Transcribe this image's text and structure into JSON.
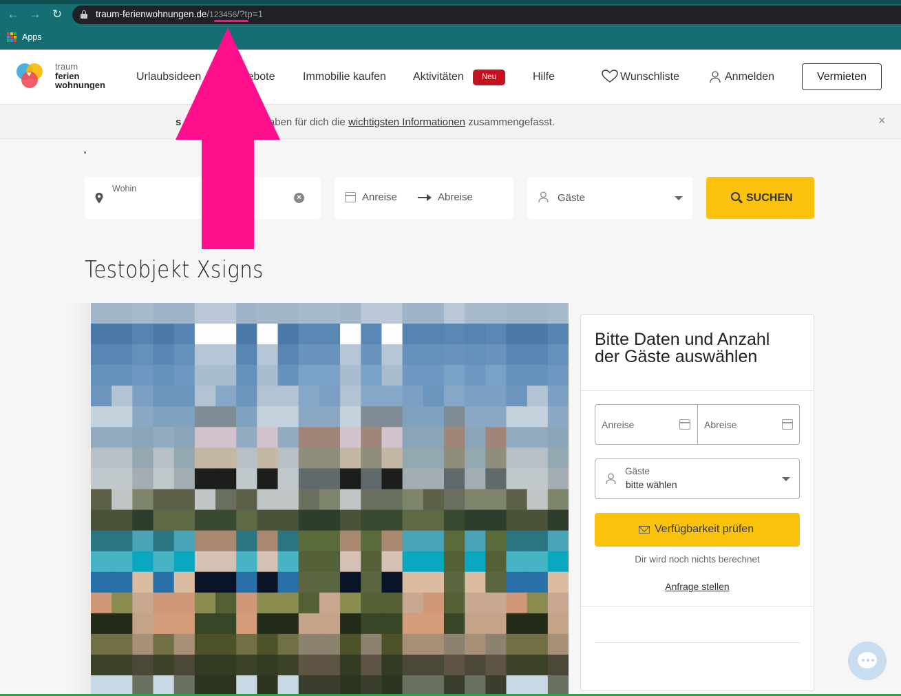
{
  "browser": {
    "url_host": "traum-ferienwohnungen.de",
    "url_sep": "/",
    "url_id": "123456",
    "url_rest": "/?tp=1",
    "bookmark_apps": "Apps"
  },
  "colors": {
    "accent_yellow": "#fbc20d",
    "badge_red": "#c4131f",
    "annotation_pink": "#ff0f8c",
    "chrome_teal": "#156e72"
  },
  "header": {
    "logo": [
      "traum",
      "ferien",
      "wohnungen"
    ],
    "nav": [
      "Urlaubsideen",
      "Angebote",
      "Immobilie kaufen",
      "Aktivitäten",
      "Hilfe"
    ],
    "badge_new": "Neu",
    "wishlist": "Wunschliste",
    "login": "Anmelden",
    "rent_button": "Vermieten"
  },
  "banner": {
    "prefix": "s (COVID-19):",
    "text1": " Wir haben für dich die ",
    "link": "wichtigsten Informationen",
    "text2": " zusammengefasst."
  },
  "search": {
    "where_label": "Wohin",
    "arrival": "Anreise",
    "departure": "Abreise",
    "guests": "Gäste",
    "search_button": "SUCHEN"
  },
  "page": {
    "title": "Testobjekt Xsigns"
  },
  "booking": {
    "title": "Bitte Daten und Anzahl der Gäste auswählen",
    "arrival": "Anreise",
    "departure": "Abreise",
    "guests_label": "Gäste",
    "guests_value": "bitte wählen",
    "check_button": "Verfügbarkeit prüfen",
    "no_charge": "Dir wird noch nichts berechnet",
    "inquiry": "Anfrage stellen"
  },
  "icons": [
    "back-arrow-icon",
    "forward-arrow-icon",
    "reload-icon",
    "lock-icon",
    "apps-grid-icon",
    "heart-icon",
    "user-icon",
    "close-icon",
    "location-pin-icon",
    "clear-icon",
    "calendar-icon",
    "arrow-right-icon",
    "caret-down-icon",
    "search-icon",
    "envelope-icon",
    "chat-icon"
  ]
}
